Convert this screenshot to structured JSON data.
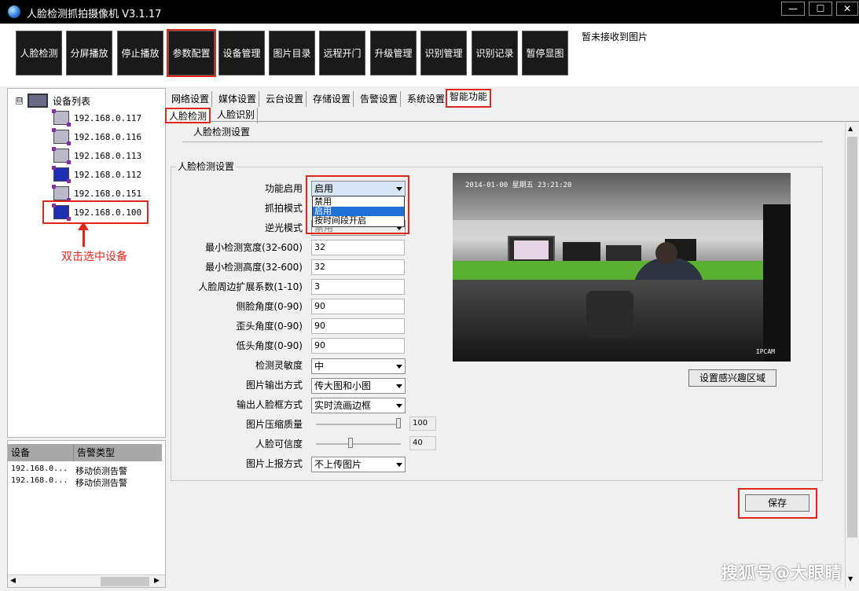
{
  "window": {
    "title": "人脸检测抓拍摄像机  V3.1.17",
    "controls": [
      "—",
      "☐",
      "✕"
    ]
  },
  "toolbar": {
    "buttons": [
      "人脸检测",
      "分屏播放",
      "停止播放",
      "参数配置",
      "设备管理",
      "图片目录",
      "远程开门",
      "升级管理",
      "识别管理",
      "识别记录",
      "暂停显图"
    ],
    "active": "参数配置",
    "status": "暂未接收到图片"
  },
  "device_tree": {
    "root_label": "设备列表",
    "expander": "⊟",
    "devices": [
      {
        "ip": "192.168.0.117",
        "online": false
      },
      {
        "ip": "192.168.0.116",
        "online": false
      },
      {
        "ip": "192.168.0.113",
        "online": false
      },
      {
        "ip": "192.168.0.112",
        "online": true
      },
      {
        "ip": "192.168.0.151",
        "online": false
      },
      {
        "ip": "192.168.0.100",
        "online": true
      }
    ],
    "annotation": "双击选中设备"
  },
  "alarm_list": {
    "headers": [
      "设备",
      "告警类型"
    ],
    "rows": [
      {
        "device": "192.168.0...",
        "type": "移动侦测告警"
      },
      {
        "device": "192.168.0...",
        "type": "移动侦测告警"
      }
    ]
  },
  "tabs": {
    "main": [
      "网络设置",
      "媒体设置",
      "云台设置",
      "存储设置",
      "告警设置",
      "系统设置",
      "智能功能"
    ],
    "main_active": "智能功能",
    "sub": [
      "人脸检测",
      "人脸识别"
    ],
    "sub_active": "人脸检测"
  },
  "settings": {
    "title": "人脸检测设置",
    "group_title": "人脸检测设置",
    "func_enable": {
      "label": "功能启用",
      "value": "启用",
      "options": [
        "禁用",
        "启用",
        "按时间段开启"
      ],
      "highlighted": "启用"
    },
    "capture_mode": {
      "label": "抓拍模式"
    },
    "backlight_mode": {
      "label": "逆光模式",
      "value": "禁用"
    },
    "min_width": {
      "label": "最小检测宽度(32-600)",
      "value": "32"
    },
    "min_height": {
      "label": "最小检测高度(32-600)",
      "value": "32"
    },
    "expand_factor": {
      "label": "人脸周边扩展系数(1-10)",
      "value": "3"
    },
    "side_angle": {
      "label": "侧脸角度(0-90)",
      "value": "90"
    },
    "tilt_angle": {
      "label": "歪头角度(0-90)",
      "value": "90"
    },
    "down_angle": {
      "label": "低头角度(0-90)",
      "value": "90"
    },
    "sensitivity": {
      "label": "检测灵敏度",
      "value": "中"
    },
    "image_output": {
      "label": "图片输出方式",
      "value": "传大图和小图"
    },
    "face_box_output": {
      "label": "输出人脸框方式",
      "value": "实时流画边框"
    },
    "compression": {
      "label": "图片压缩质量",
      "value": "100",
      "level": 1.0
    },
    "confidence": {
      "label": "人脸可信度",
      "value": "40",
      "level": 0.4
    },
    "upload_mode": {
      "label": "图片上报方式",
      "value": "不上传图片"
    }
  },
  "preview": {
    "osd_time": "2014-01-00 星期五 23:21:20",
    "camera_tag": "IPCAM"
  },
  "buttons": {
    "roi": "设置感兴趣区域",
    "save": "保存"
  },
  "scrollbar": {
    "up": "▲",
    "down": "▼",
    "left": "◀",
    "right": "▶"
  },
  "watermark": "搜狐号@大眼睛",
  "colors": {
    "highlight_red": "#e0271b",
    "selection_blue": "#1e6fd6",
    "toolbar_button": "#1a1a1a"
  }
}
